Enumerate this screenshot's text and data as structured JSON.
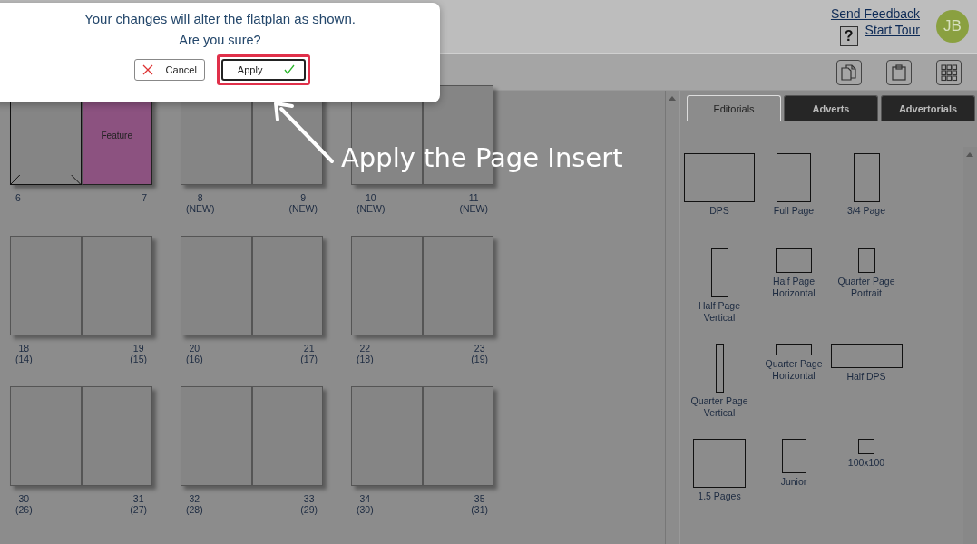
{
  "header": {
    "feedback_link": "Send Feedback",
    "help": "?",
    "tour_link": "Start Tour",
    "avatar": "JB"
  },
  "dialog": {
    "message": "Your changes will alter the flatplan as shown.",
    "question": "Are you sure?",
    "buttons": [
      {
        "label": "Cancel",
        "kind": "cancel",
        "highlighted": false
      },
      {
        "label": "Apply",
        "kind": "apply",
        "highlighted": true
      }
    ]
  },
  "annotation": {
    "text": "Apply the Page Insert"
  },
  "flatplan": {
    "rows": [
      [
        {
          "pages": [
            {
              "number": "6",
              "kind": "marked"
            },
            {
              "number": "7",
              "kind": "feature",
              "title": "Feature"
            }
          ]
        },
        {
          "pages": [
            {
              "number": "8",
              "sub": "(NEW)",
              "kind": "blank"
            },
            {
              "number": "9",
              "sub": "(NEW)",
              "kind": "blank"
            }
          ]
        },
        {
          "pages": [
            {
              "number": "10",
              "sub": "(NEW)",
              "kind": "blank"
            },
            {
              "number": "11",
              "sub": "(NEW)",
              "kind": "blank"
            }
          ]
        }
      ],
      [
        {
          "pages": [
            {
              "number": "18",
              "sub": "(14)",
              "kind": "blank"
            },
            {
              "number": "19",
              "sub": "(15)",
              "kind": "blank"
            }
          ]
        },
        {
          "pages": [
            {
              "number": "20",
              "sub": "(16)",
              "kind": "blank"
            },
            {
              "number": "21",
              "sub": "(17)",
              "kind": "blank"
            }
          ]
        },
        {
          "pages": [
            {
              "number": "22",
              "sub": "(18)",
              "kind": "blank"
            },
            {
              "number": "23",
              "sub": "(19)",
              "kind": "blank"
            }
          ]
        }
      ],
      [
        {
          "pages": [
            {
              "number": "30",
              "sub": "(26)",
              "kind": "blank"
            },
            {
              "number": "31",
              "sub": "(27)",
              "kind": "blank"
            }
          ]
        },
        {
          "pages": [
            {
              "number": "32",
              "sub": "(28)",
              "kind": "blank"
            },
            {
              "number": "33",
              "sub": "(29)",
              "kind": "blank"
            }
          ]
        },
        {
          "pages": [
            {
              "number": "34",
              "sub": "(30)",
              "kind": "blank"
            },
            {
              "number": "35",
              "sub": "(31)",
              "kind": "blank"
            }
          ]
        }
      ]
    ]
  },
  "panel": {
    "tabs": [
      {
        "label": "Editorials",
        "selected": true
      },
      {
        "label": "Adverts",
        "selected": false
      },
      {
        "label": "Advertorials",
        "selected": false
      }
    ],
    "items": [
      {
        "label": "DPS",
        "kind": "dps"
      },
      {
        "label": "Full Page",
        "kind": "full"
      },
      {
        "label": "3/4 Page",
        "kind": "three_quarter"
      },
      {
        "label": "Half Page Vertical",
        "kind": "half_vertical"
      },
      {
        "label": "Half Page Horizontal",
        "kind": "half_horizontal"
      },
      {
        "label": "Quarter Page Portrait",
        "kind": "quarter_portrait"
      },
      {
        "label": "Quarter Page Vertical",
        "kind": "quarter_vertical"
      },
      {
        "label": "Quarter Page Horizontal",
        "kind": "quarter_horizontal"
      },
      {
        "label": "Half DPS",
        "kind": "half_dps"
      },
      {
        "label": "1.5 Pages",
        "kind": "one_half"
      },
      {
        "label": "Junior",
        "kind": "junior"
      },
      {
        "label": "100x100",
        "kind": "square"
      }
    ]
  }
}
